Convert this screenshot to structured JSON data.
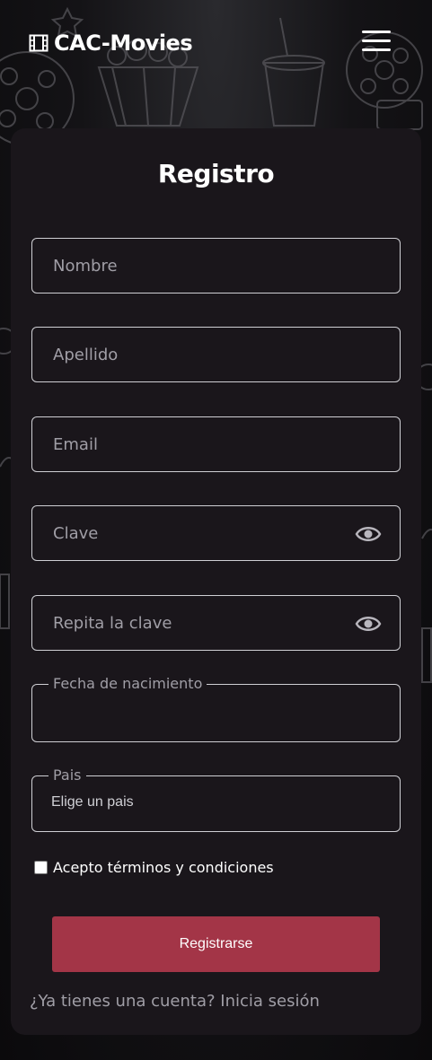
{
  "header": {
    "brand": "CAC-Movies",
    "brand_icon": "film-icon",
    "menu_icon": "hamburger-menu-icon"
  },
  "form": {
    "title": "Registro",
    "fields": {
      "nombre": {
        "placeholder": "Nombre",
        "value": ""
      },
      "apellido": {
        "placeholder": "Apellido",
        "value": ""
      },
      "email": {
        "placeholder": "Email",
        "value": ""
      },
      "clave": {
        "placeholder": "Clave",
        "value": "",
        "icon": "eye-icon"
      },
      "repita_clave": {
        "placeholder": "Repita la clave",
        "value": "",
        "icon": "eye-icon"
      },
      "fecha": {
        "label": "Fecha de nacimiento",
        "value": ""
      },
      "pais": {
        "label": "Pais",
        "selected": "Elige un pais"
      }
    },
    "terms": {
      "label": "Acepto términos y condiciones",
      "checked": false
    },
    "submit_label": "Registrarse",
    "login_prompt": "¿Ya tienes una cuenta? Inicia sesión"
  },
  "colors": {
    "page_bg": "#0d0c0e",
    "card_bg": "#1a161b",
    "border": "#cfcfd4",
    "placeholder": "#a09ea6",
    "accent": "#a33547"
  }
}
